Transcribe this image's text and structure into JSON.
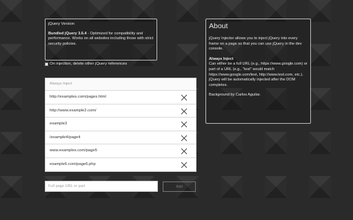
{
  "version": {
    "heading": "jQuery Version",
    "bundled_label": "Bundled jQuery 3.6.4",
    "bundled_description": " - Optimized for compatibility and performance. Works on all websites including those with strict security policies."
  },
  "options": {
    "delete_refs_label": "On injection, delete other jQuery references",
    "delete_refs_checked": false
  },
  "always_inject": {
    "header": "Always Inject",
    "urls": [
      "http://examples.com/pages.html",
      "http://www.example2.com/",
      "example3",
      "/example4/page4",
      "www.examples.com/page5",
      "example6.com/page6.php"
    ],
    "remove_icon": "close-icon"
  },
  "add_form": {
    "placeholder": "Full page URL or part",
    "button_label": "Add"
  },
  "about": {
    "title": "About",
    "intro": "jQuery Injector allows you to inject jQuery into every frame on a page so that you can use jQuery in the dev console.",
    "always_inject_heading": "Always Inject",
    "always_inject_text": "Can either be a full URL (e.g., https://www.google.com) or part of a URL (e.g., \"test\" would match https://www.google.com/test, http://www.test.com, etc.). jQuery will be automatically injected after the DOM completes.",
    "background_credit": "Background by Carlos Aguilar."
  },
  "colors": {
    "background": "#2a2a2a",
    "panel_border": "#bdbdbd",
    "text": "#e8e8e8",
    "list_background": "#ffffff",
    "list_text": "#333333"
  }
}
